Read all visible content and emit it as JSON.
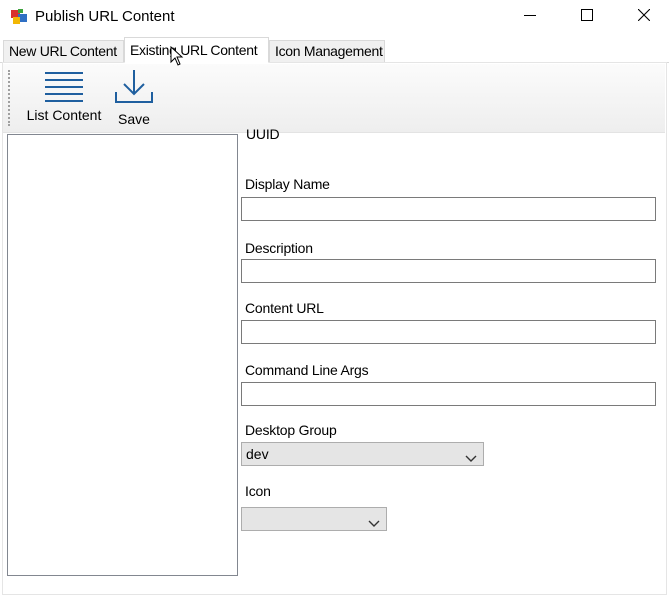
{
  "window": {
    "title": "Publish URL Content",
    "app_icon": "app-window-icon",
    "controls": [
      "minimize-icon",
      "maximize-icon",
      "close-icon"
    ]
  },
  "tabs": [
    {
      "label": "New URL Content",
      "active": false
    },
    {
      "label": "Existing URL Content",
      "active": true
    },
    {
      "label": "Icon Management",
      "active": false
    }
  ],
  "toolbar": {
    "list_content_label": "List Content",
    "list_content_icon": "list-icon",
    "save_label": "Save",
    "save_icon": "download-icon"
  },
  "form": {
    "uuid_label": "UUID",
    "display_name_label": "Display Name",
    "display_name_value": "",
    "description_label": "Description",
    "description_value": "",
    "content_url_label": "Content URL",
    "content_url_value": "",
    "command_line_args_label": "Command Line Args",
    "command_line_args_value": "",
    "desktop_group_label": "Desktop Group",
    "desktop_group_value": "dev",
    "icon_label": "Icon",
    "icon_value": ""
  },
  "colors": {
    "icon_blue": "#1f5f9f",
    "combo_bg": "#e5e5e5"
  }
}
